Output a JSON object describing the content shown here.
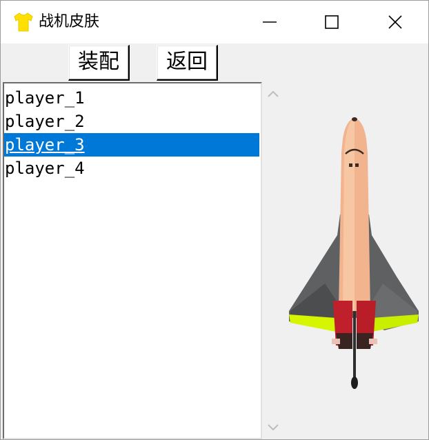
{
  "window": {
    "title": "战机皮肤",
    "icon": "tshirt-icon",
    "accent_color": "#0078d7",
    "controls": [
      "minimize-icon",
      "maximize-icon",
      "close-icon"
    ]
  },
  "toolbar": {
    "equip_label": "装配",
    "back_label": "返回"
  },
  "skin_list": {
    "items": [
      {
        "label": "player_1",
        "selected": false
      },
      {
        "label": "player_2",
        "selected": false
      },
      {
        "label": "player_3",
        "selected": true
      },
      {
        "label": "player_4",
        "selected": false
      }
    ]
  },
  "preview": {
    "image": "space-shuttle-skin",
    "scroll_icons": [
      "chevron-up-icon",
      "chevron-down-icon"
    ]
  }
}
